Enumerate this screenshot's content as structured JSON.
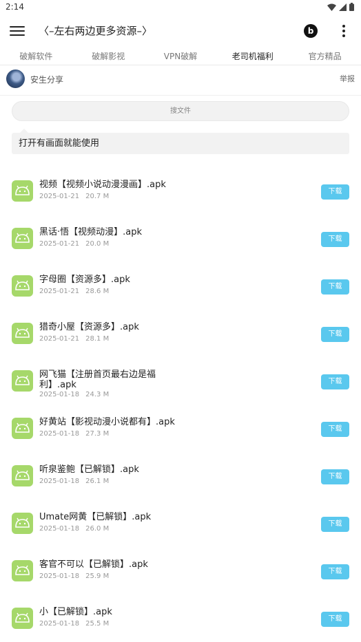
{
  "status": {
    "time": "2:14"
  },
  "header": {
    "title": "〈–左右两边更多资源–〉",
    "b_label": "b"
  },
  "tabs": [
    {
      "label": "破解软件"
    },
    {
      "label": "破解影视"
    },
    {
      "label": "VPN破解"
    },
    {
      "label": "老司机福利",
      "active": true
    },
    {
      "label": "官方精品"
    }
  ],
  "author": {
    "name": "安生分享",
    "report": "举报"
  },
  "search": {
    "placeholder": "搜文件"
  },
  "tip": "打开有画面就能使用",
  "download_label": "下载",
  "files": [
    {
      "name": "视频【视频小说动漫漫画】.apk",
      "date": "2025-01-21",
      "size": "20.7 M"
    },
    {
      "name": "黑话·悟【视频动漫】.apk",
      "date": "2025-01-21",
      "size": "20.0 M"
    },
    {
      "name": "字母圈【资源多】.apk",
      "date": "2025-01-21",
      "size": "28.6 M"
    },
    {
      "name": "猎奇小屋【资源多】.apk",
      "date": "2025-01-21",
      "size": "28.1 M"
    },
    {
      "name": "网飞猫【注册首页最右边是福利】.apk",
      "date": "2025-01-18",
      "size": "24.3 M"
    },
    {
      "name": "好黄站【影视动漫小说都有】.apk",
      "date": "2025-01-18",
      "size": "27.3 M"
    },
    {
      "name": "听泉鉴鲍【已解锁】.apk",
      "date": "2025-01-18",
      "size": "26.1 M"
    },
    {
      "name": "Umate网黄【已解锁】.apk",
      "date": "2025-01-18",
      "size": "26.0 M"
    },
    {
      "name": "客官不可以【已解锁】.apk",
      "date": "2025-01-18",
      "size": "25.9 M"
    },
    {
      "name": "小【已解锁】.apk",
      "date": "2025-01-18",
      "size": "25.5 M"
    }
  ]
}
